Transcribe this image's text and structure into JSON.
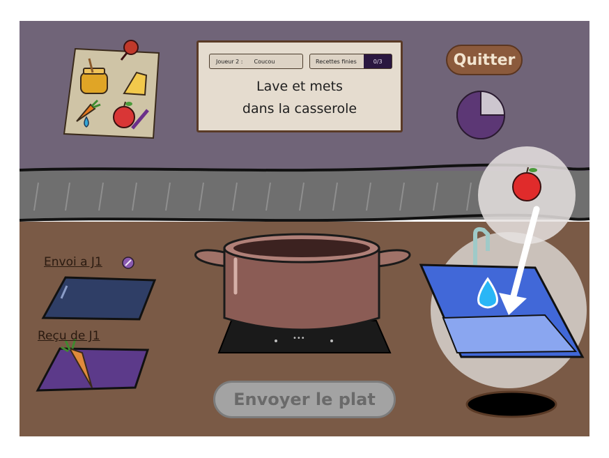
{
  "hud": {
    "player_label": "Joueur 2 :",
    "player_name": "Coucou",
    "recipes_label": "Recettes finies",
    "recipes_count": "0/3",
    "instruction_line1": "Lave et mets",
    "instruction_line2": "dans la casserole"
  },
  "buttons": {
    "quit_label": "Quitter",
    "send_dish_label": "Envoyer le plat"
  },
  "stations": {
    "send_label": "Envoi a J1",
    "received_label": "Reçu de J1"
  },
  "timer": {
    "elapsed_fraction": 0.75
  },
  "recipe_card": {
    "icons": [
      "honey-jar-icon",
      "cheese-icon",
      "carrot-icon",
      "water-drop-icon",
      "apple-icon",
      "knife-icon"
    ]
  },
  "hint": {
    "item": "apple-icon",
    "target": "sink",
    "icon": "water-drop-icon"
  },
  "stove": {
    "indicator": "•••"
  },
  "colors": {
    "wall": "#706478",
    "counter": "#7a5a46",
    "belt": "#6f6f6f",
    "accent_purple": "#5c3775",
    "sink_blue": "#4168d8"
  }
}
